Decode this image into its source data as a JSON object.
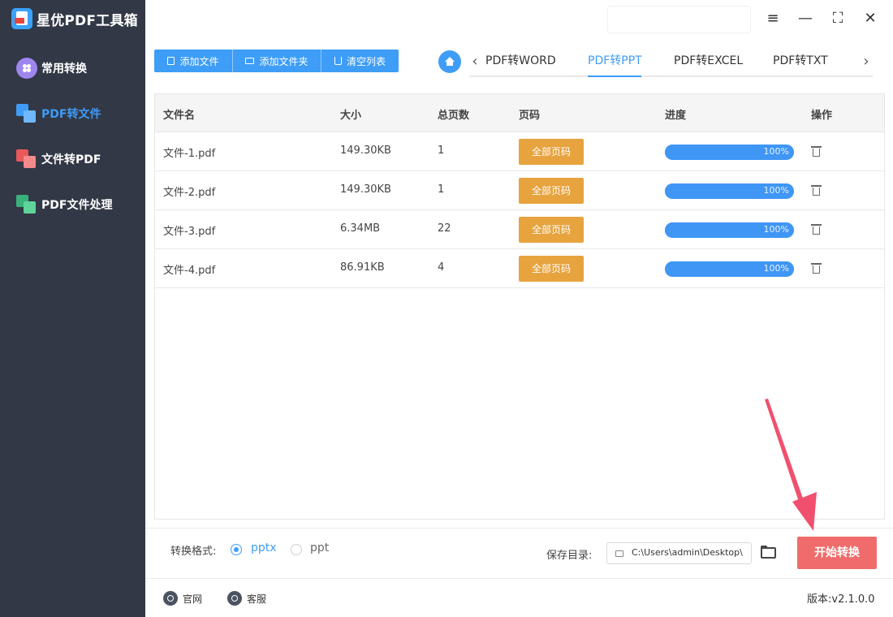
{
  "app": {
    "title": "星优PDF工具箱"
  },
  "sidebar": {
    "items": [
      {
        "label": "常用转换",
        "active": false,
        "icon": "apps-icon"
      },
      {
        "label": "PDF转文件",
        "active": true,
        "icon": "pdf-to-file-icon"
      },
      {
        "label": "文件转PDF",
        "active": false,
        "icon": "file-to-pdf-icon"
      },
      {
        "label": "PDF文件处理",
        "active": false,
        "icon": "pdf-process-icon"
      }
    ]
  },
  "window_controls": {
    "settings": "≡",
    "minimize": "—",
    "maximize": "⛶",
    "close": "✕"
  },
  "toolbar": {
    "add_file": "添加文件",
    "add_folder": "添加文件夹",
    "clear_list": "清空列表"
  },
  "tabs": {
    "items": [
      "PDF转WORD",
      "PDF转PPT",
      "PDF转EXCEL",
      "PDF转TXT"
    ],
    "active_index": 1,
    "prev": "‹",
    "next": "›"
  },
  "table": {
    "headers": [
      "文件名",
      "大小",
      "总页数",
      "页码",
      "进度",
      "操作"
    ],
    "rows": [
      {
        "name": "文件-1.pdf",
        "size": "149.30KB",
        "pages": "1",
        "page_btn": "全部页码",
        "progress": 1.0,
        "progress_label": "100%"
      },
      {
        "name": "文件-2.pdf",
        "size": "149.30KB",
        "pages": "1",
        "page_btn": "全部页码",
        "progress": 1.0,
        "progress_label": "100%"
      },
      {
        "name": "文件-3.pdf",
        "size": "6.34MB",
        "pages": "22",
        "page_btn": "全部页码",
        "progress": 1.0,
        "progress_label": "100%"
      },
      {
        "name": "文件-4.pdf",
        "size": "86.91KB",
        "pages": "4",
        "page_btn": "全部页码",
        "progress": 1.0,
        "progress_label": "100%"
      }
    ]
  },
  "format": {
    "label": "转换格式:",
    "options": [
      "pptx",
      "ppt"
    ],
    "selected": "pptx"
  },
  "save": {
    "label": "保存目录:",
    "path": "C:\\Users\\admin\\Desktop\\"
  },
  "start_button": "开始转换",
  "footer": {
    "website": "官网",
    "support": "客服",
    "version": "版本:v2.1.0.0"
  },
  "colors": {
    "accent": "#3e9df6",
    "sidebar_bg": "#323846",
    "page_button": "#e7a33e",
    "start_button": "#f06c6c",
    "arrow": "#f0506e"
  }
}
